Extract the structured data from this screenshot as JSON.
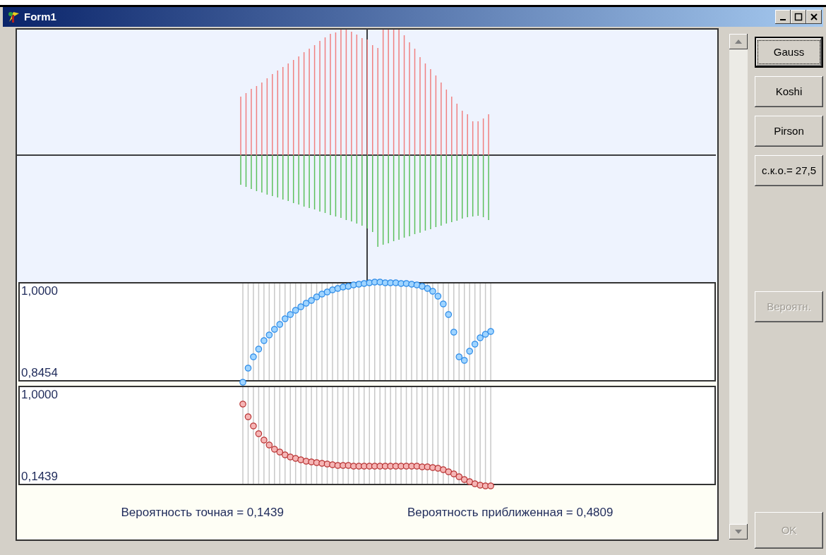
{
  "window": {
    "title": "Form1"
  },
  "plots": [
    {
      "max_label": "1,0000",
      "min_label": "0,8454",
      "kind": "blue"
    },
    {
      "max_label": "1,0000",
      "min_label": "0,1439",
      "kind": "red"
    }
  ],
  "results": [
    "Вероятность точная = 0,1439",
    "Вероятность приближенная = 0,4809"
  ],
  "buttons": [
    {
      "label": "Gauss",
      "disabled": false,
      "focused": true
    },
    {
      "label": "Koshi",
      "disabled": false,
      "focused": false
    },
    {
      "label": "Pirson",
      "disabled": false,
      "focused": false
    },
    {
      "label": "с.к.о.= 27,5",
      "disabled": false,
      "focused": false
    },
    {
      "label": "Вероятн.",
      "disabled": true,
      "focused": false
    },
    {
      "label": "OK",
      "disabled": true,
      "focused": false
    }
  ]
}
